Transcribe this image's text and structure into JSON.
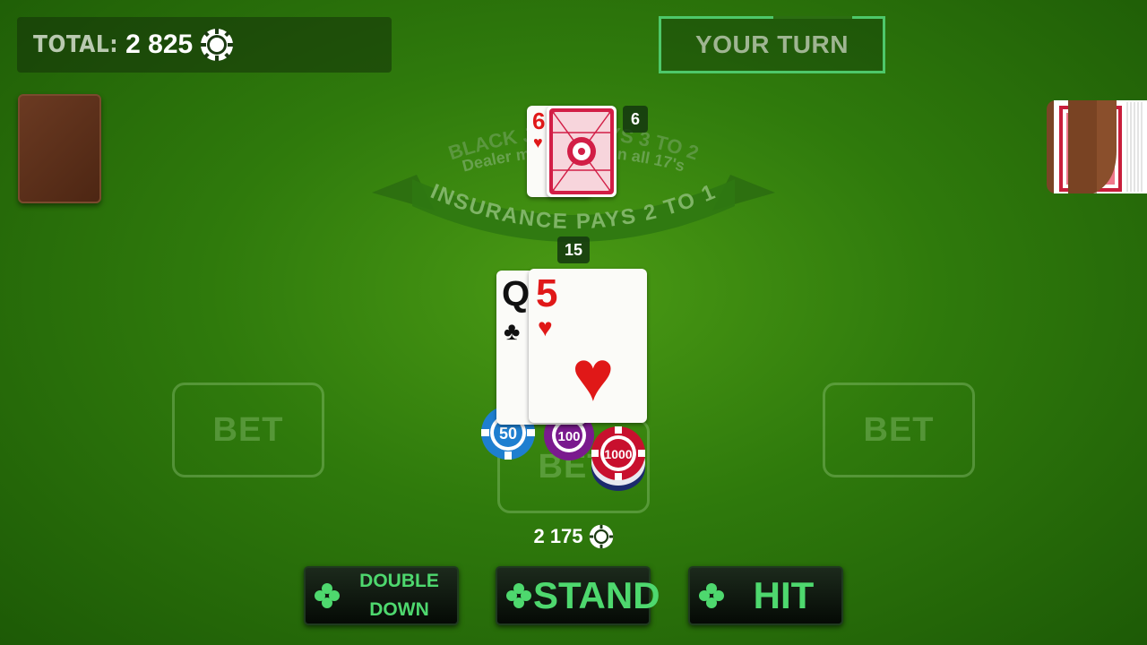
{
  "header": {
    "total_label": "TOTAL:",
    "total_value": "2 825",
    "turn_text": "YOUR TURN"
  },
  "table_text": {
    "line1": "BLACK JACK PAYS 3 TO 2",
    "line2": "Dealer must stand on all 17's",
    "line3": "INSURANCE PAYS 2 TO 1"
  },
  "dealer": {
    "count": "6",
    "cards": [
      {
        "rank": "6",
        "suit": "♥",
        "color": "red"
      }
    ]
  },
  "player": {
    "count": "15",
    "cards": [
      {
        "rank": "Q",
        "suit": "♣",
        "color": "black"
      },
      {
        "rank": "5",
        "suit": "♥",
        "color": "red"
      }
    ],
    "bet_amount": "2 175",
    "chips": [
      "50",
      "100",
      "1000"
    ]
  },
  "bet_spots": {
    "left": "BET",
    "center": "BET",
    "right": "BET"
  },
  "actions": {
    "double_down_line1": "DOUBLE",
    "double_down_line2": "DOWN",
    "stand": "STAND",
    "hit": "HIT"
  },
  "colors": {
    "felt": "#2f7a0c",
    "accent_green": "#4ed86e",
    "card_red": "#e01818"
  }
}
